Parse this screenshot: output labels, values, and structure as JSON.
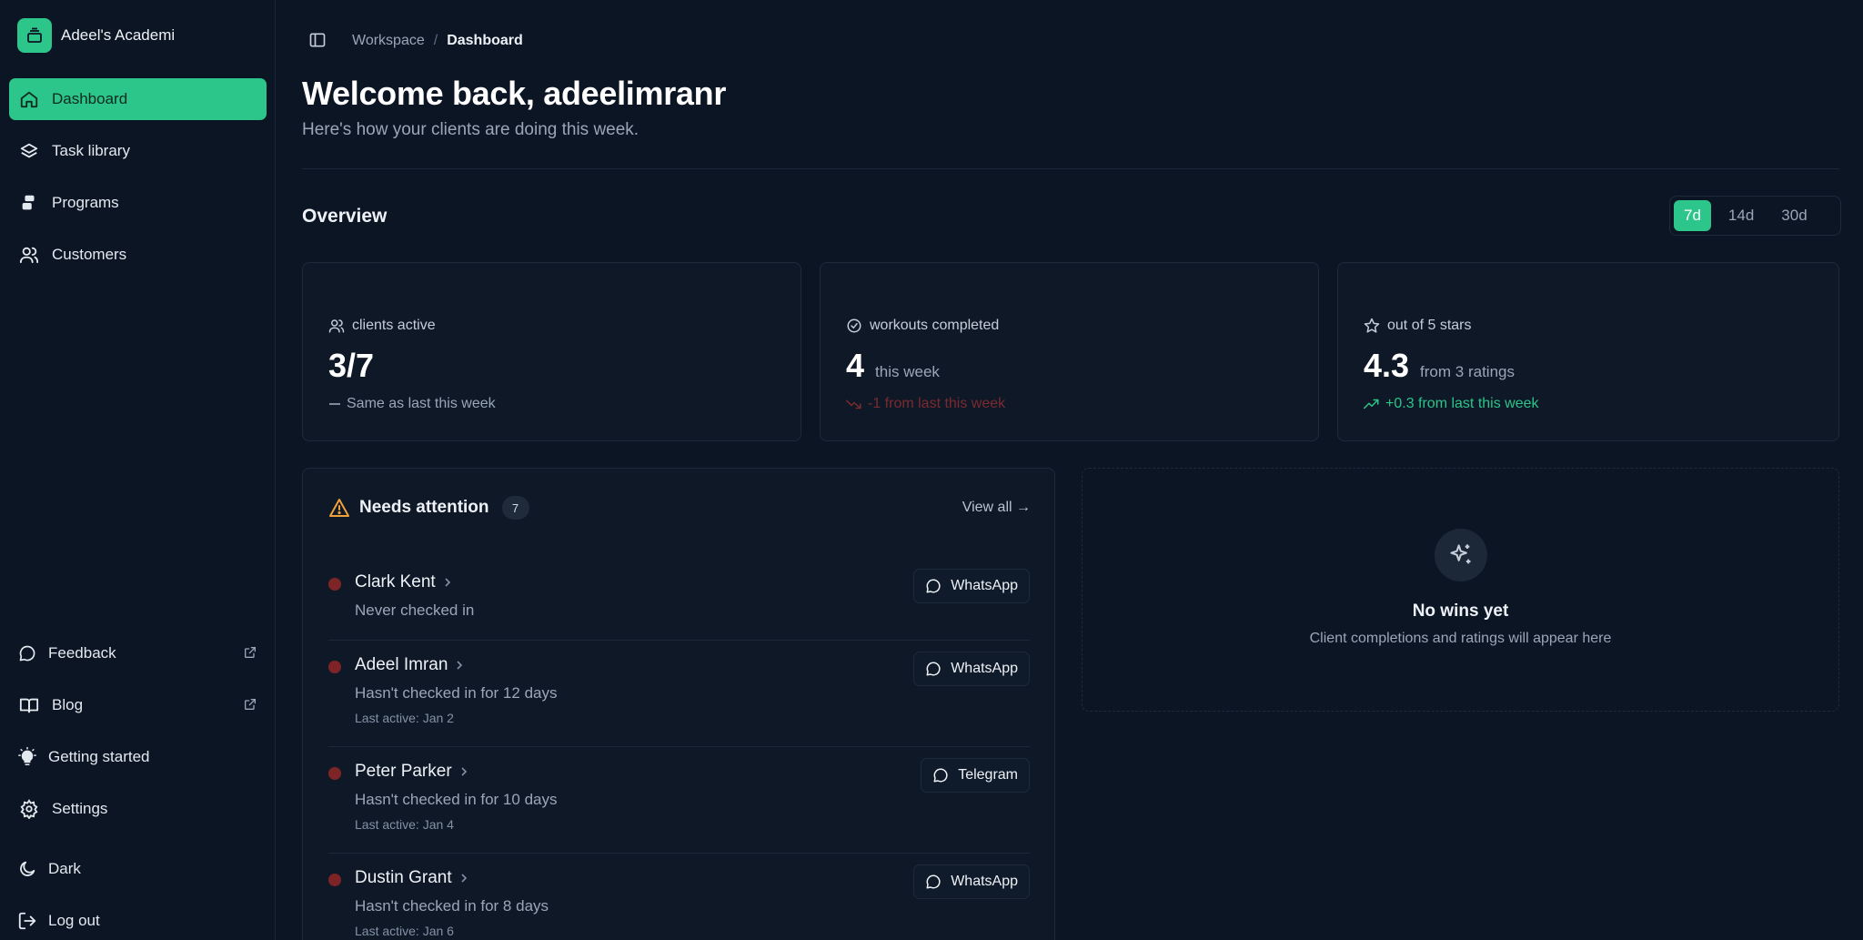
{
  "brand": {
    "name": "Adeel's Academi"
  },
  "sidebar": {
    "items": [
      {
        "label": "Dashboard",
        "icon": "home-icon",
        "active": true
      },
      {
        "label": "Task library",
        "icon": "layers-icon"
      },
      {
        "label": "Programs",
        "icon": "programs-icon"
      },
      {
        "label": "Customers",
        "icon": "users-icon"
      }
    ],
    "bottom": [
      {
        "label": "Feedback",
        "icon": "message-icon",
        "external": true
      },
      {
        "label": "Blog",
        "icon": "book-icon",
        "external": true
      },
      {
        "label": "Getting started",
        "icon": "lightbulb-icon"
      },
      {
        "label": "Settings",
        "icon": "gear-icon"
      }
    ],
    "theme_label": "Dark",
    "logout_label": "Log out"
  },
  "breadcrumb": {
    "parent": "Workspace",
    "separator": "/",
    "current": "Dashboard"
  },
  "header": {
    "title": "Welcome back, adeelimranr",
    "subtitle": "Here's how your clients are doing this week."
  },
  "overview": {
    "title": "Overview",
    "ranges": [
      "7d",
      "14d",
      "30d"
    ],
    "selected_range": "7d"
  },
  "stats": [
    {
      "label": "clients active",
      "value": "3/7",
      "unit": "",
      "delta": "Same as last this week",
      "trend": "neutral"
    },
    {
      "label": "workouts completed",
      "value": "4",
      "unit": "this week",
      "delta": "-1 from last this week",
      "trend": "down"
    },
    {
      "label": "out of 5 stars",
      "value": "4.3",
      "unit": "from 3 ratings",
      "delta": "+0.3 from last this week",
      "trend": "up"
    }
  ],
  "attention": {
    "title": "Needs attention",
    "count": "7",
    "view_all": "View all →",
    "rows": [
      {
        "name": "Clark Kent",
        "message": "Never checked in",
        "last_active": "",
        "channel": "WhatsApp"
      },
      {
        "name": "Adeel Imran",
        "message": "Hasn't checked in for 12 days",
        "last_active": "Last active: Jan 2",
        "channel": "WhatsApp"
      },
      {
        "name": "Peter Parker",
        "message": "Hasn't checked in for 10 days",
        "last_active": "Last active: Jan 4",
        "channel": "Telegram"
      },
      {
        "name": "Dustin Grant",
        "message": "Hasn't checked in for 8 days",
        "last_active": "Last active: Jan 6",
        "channel": "WhatsApp"
      }
    ]
  },
  "wins": {
    "title": "No wins yet",
    "subtitle": "Client completions and ratings will appear here"
  },
  "colors": {
    "accent": "#2cc58a",
    "background": "#0c1524",
    "danger": "#7e2427",
    "warning": "#f0a13a"
  }
}
